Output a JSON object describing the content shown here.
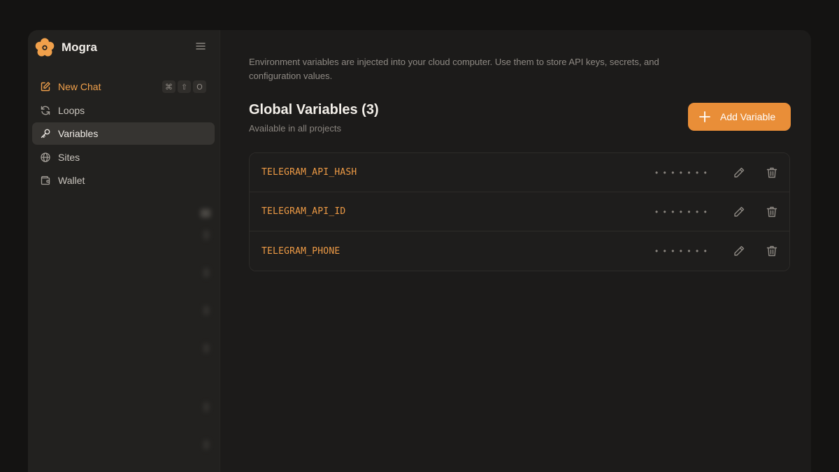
{
  "brand": {
    "name": "Mogra",
    "logo_icon": "flower-logo-icon",
    "accent": "#f0a04b"
  },
  "sidebar": {
    "menu_icon": "hamburger-menu-icon",
    "nav": [
      {
        "label": "New Chat",
        "icon": "edit-icon",
        "shortcut": [
          "⌘",
          "⇧",
          "O"
        ]
      },
      {
        "label": "Loops",
        "icon": "refresh-icon"
      },
      {
        "label": "Variables",
        "icon": "key-icon",
        "active": true
      },
      {
        "label": "Sites",
        "icon": "globe-icon"
      },
      {
        "label": "Wallet",
        "icon": "wallet-icon"
      }
    ]
  },
  "main": {
    "intro": "Environment variables are injected into your cloud computer. Use them to store API keys, secrets, and configuration values.",
    "section_title": "Global Variables (3)",
    "section_subtitle": "Available in all projects",
    "add_button_label": "Add Variable",
    "add_button_color": "#e98e38",
    "variables": [
      {
        "name": "TELEGRAM_API_HASH",
        "masked": "•••••••"
      },
      {
        "name": "TELEGRAM_API_ID",
        "masked": "•••••••"
      },
      {
        "name": "TELEGRAM_PHONE",
        "masked": "•••••••"
      }
    ]
  }
}
